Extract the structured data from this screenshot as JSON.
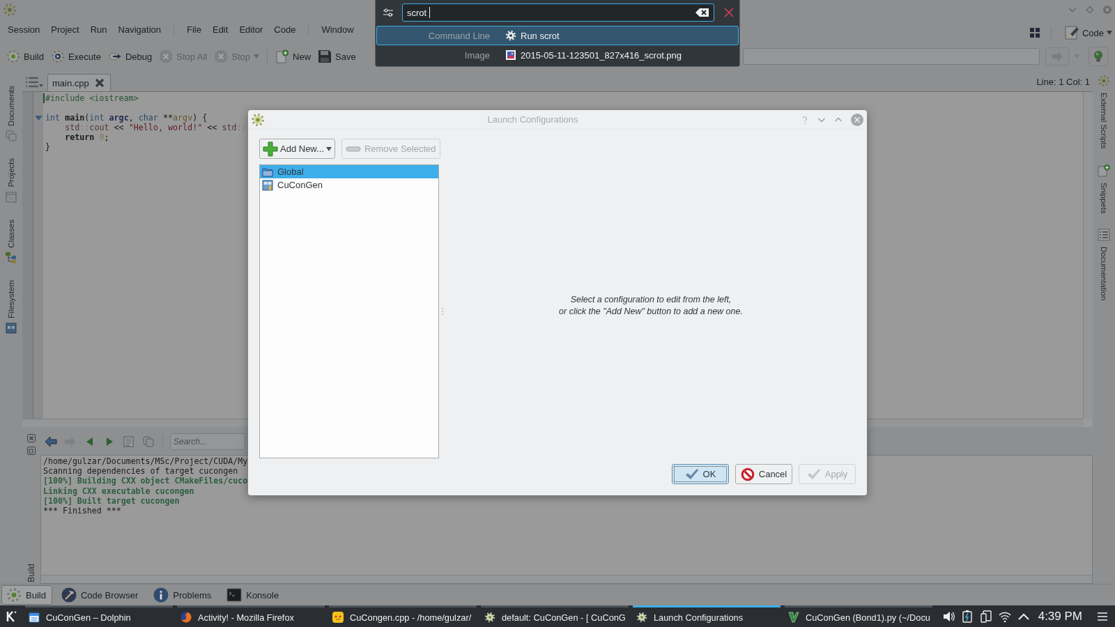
{
  "ide": {
    "menu": [
      {
        "items": [
          "Session",
          "Project",
          "Run",
          "Navigation"
        ]
      },
      {
        "items": [
          "File",
          "Edit",
          "Editor",
          "Code"
        ]
      },
      {
        "items": [
          "Window"
        ]
      }
    ],
    "area_button": {
      "label": "Code",
      "dropdown": true
    },
    "toolbar": [
      {
        "items": [
          {
            "label": "Build",
            "disabled": false,
            "dropdown": false
          },
          {
            "label": "Execute",
            "disabled": false,
            "dropdown": false
          },
          {
            "label": "Debug",
            "disabled": false,
            "dropdown": false
          },
          {
            "label": "Stop All",
            "disabled": true,
            "dropdown": false
          },
          {
            "label": "Stop",
            "disabled": true,
            "dropdown": true
          }
        ]
      },
      {
        "items": [
          {
            "label": "New",
            "disabled": false,
            "dropdown": false
          },
          {
            "label": "Save",
            "disabled": false,
            "dropdown": false
          }
        ]
      }
    ],
    "editor_tabs": [
      {
        "label": "main.cpp",
        "selected": true
      }
    ],
    "cursor_position": "Line: 1 Col: 1",
    "left_dock": [
      {
        "label": "Documents"
      },
      {
        "label": "Projects"
      },
      {
        "label": "Classes"
      },
      {
        "label": "Filesystem"
      }
    ],
    "right_dock": [
      {
        "label": "External Scripts"
      },
      {
        "label": "Snippets"
      },
      {
        "label": "Documentation"
      }
    ],
    "code": [
      {
        "lines": [
          {
            "fold": false,
            "tokens": [
              {
                "text": "#include <iostream>",
                "kind": "directive"
              }
            ]
          }
        ]
      },
      {
        "lines": [
          {
            "fold": true,
            "tokens": [
              {
                "text": "int",
                "kind": "type"
              },
              {
                "text": " main",
                "kind": "function"
              },
              {
                "text": "(",
                "kind": "plain"
              },
              {
                "text": "int",
                "kind": "type"
              },
              {
                "text": " argc",
                "kind": "variable"
              },
              {
                "text": ", ",
                "kind": "plain"
              },
              {
                "text": "char",
                "kind": "type"
              },
              {
                "text": " **",
                "kind": "plain"
              },
              {
                "text": "argv",
                "kind": "param"
              },
              {
                "text": ") {",
                "kind": "plain"
              }
            ]
          },
          {
            "fold": false,
            "tokens": [
              {
                "text": "    std",
                "kind": "namespace"
              },
              {
                "text": "::",
                "kind": "scope"
              },
              {
                "text": "cout",
                "kind": "member"
              },
              {
                "text": " << ",
                "kind": "plain"
              },
              {
                "text": "\"Hello, world!\"",
                "kind": "string"
              },
              {
                "text": " << ",
                "kind": "plain"
              },
              {
                "text": "std",
                "kind": "namespace"
              },
              {
                "text": "::",
                "kind": "scope"
              }
            ]
          },
          {
            "fold": false,
            "tokens": [
              {
                "text": "    return",
                "kind": "control"
              },
              {
                "text": " 0",
                "kind": "number"
              },
              {
                "text": ";",
                "kind": "plain"
              }
            ]
          },
          {
            "fold": false,
            "tokens": [
              {
                "text": "}",
                "kind": "plain"
              }
            ]
          }
        ]
      }
    ],
    "build_view": {
      "label": "Build",
      "search_placeholder": "Search...",
      "output": [
        {
          "text": "/home/gulzar/Documents/MSc/Project/CUDA/My",
          "kind": "plain"
        },
        {
          "text": "Scanning dependencies of target cucongen",
          "kind": "plain"
        },
        {
          "text": "[100%] Building CXX object CMakeFiles/cuco",
          "kind": "progress"
        },
        {
          "text": "Linking CXX executable cucongen",
          "kind": "progress"
        },
        {
          "text": "[100%] Built target cucongen",
          "kind": "progress"
        },
        {
          "text": "*** Finished ***",
          "kind": "plain"
        }
      ]
    },
    "bottom_tabs": [
      {
        "label": "Build",
        "selected": true
      },
      {
        "label": "Code Browser",
        "selected": false
      },
      {
        "label": "Problems",
        "selected": false
      },
      {
        "label": "Konsole",
        "selected": false
      }
    ]
  },
  "krunner": {
    "query": "scrot",
    "results": [
      {
        "category": "Command Line",
        "label": "Run scrot",
        "selected": true
      },
      {
        "category": "Image",
        "label": "2015-05-11-123501_827x416_scrot.png",
        "selected": false
      }
    ]
  },
  "dialog": {
    "title": "Launch Configurations",
    "add_button": {
      "label": "Add New...",
      "dropdown": true
    },
    "remove_button": {
      "label": "Remove Selected",
      "disabled": true
    },
    "configurations": [
      {
        "label": "Global",
        "selected": true
      },
      {
        "label": "CuConGen",
        "selected": false
      }
    ],
    "hint": "Select a configuration to edit from the left,\nor click the \"Add New\" button to add a new one.",
    "buttons": [
      {
        "label": "OK",
        "default": true,
        "disabled": false
      },
      {
        "label": "Cancel",
        "default": false,
        "disabled": false
      },
      {
        "label": "Apply",
        "default": false,
        "disabled": true
      }
    ]
  },
  "taskbar": {
    "tasks": [
      {
        "label": "CuConGen – Dolphin",
        "active": false
      },
      {
        "label": "Activity! - Mozilla Firefox",
        "active": false
      },
      {
        "label": "CuCongen.cpp - /home/gulzar/",
        "active": false
      },
      {
        "label": "default: CuConGen - [ CuConG",
        "active": false
      },
      {
        "label": "Launch Configurations",
        "active": true
      },
      {
        "label": "CuConGen (Bond1).py (~/Docu",
        "active": false
      }
    ],
    "clock": "4:39 PM"
  }
}
